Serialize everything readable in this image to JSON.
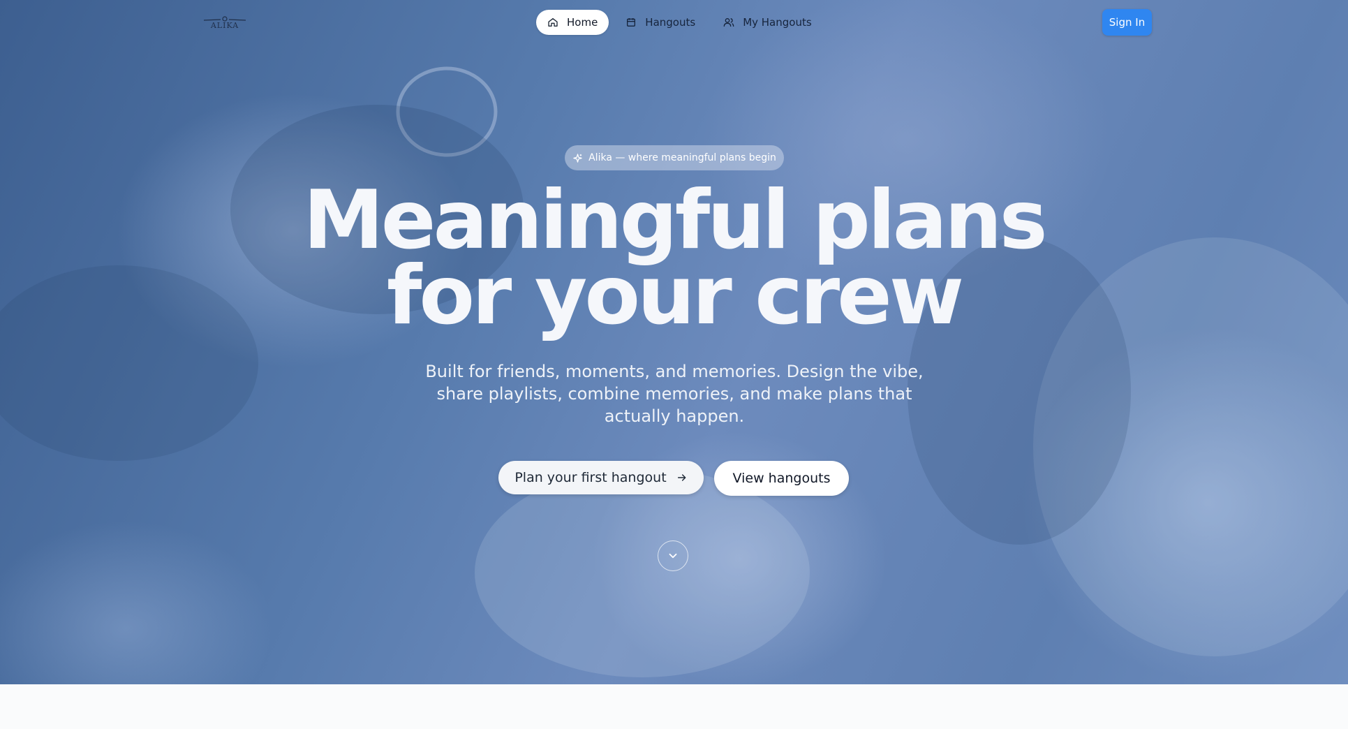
{
  "brand": {
    "logo_text": "ALIKA"
  },
  "nav": {
    "items": [
      {
        "label": "Home",
        "icon": "home-icon",
        "active": true
      },
      {
        "label": "Hangouts",
        "icon": "calendar-icon",
        "active": false
      },
      {
        "label": "My Hangouts",
        "icon": "users-icon",
        "active": false
      }
    ],
    "signin_label": "Sign In"
  },
  "hero": {
    "badge_text": "Alika — where meaningful plans begin",
    "badge_icon": "sparkles-icon",
    "headline_line1": "Meaningful plans",
    "headline_line2": "for your crew",
    "subtitle": "Built for friends, moments, and memories. Design the vibe, share playlists, combine memories, and make plans that actually happen.",
    "primary_cta": "Plan your first hangout",
    "primary_cta_icon": "arrow-right-icon",
    "secondary_cta": "View hangouts",
    "scroll_icon": "chevron-down-icon"
  },
  "colors": {
    "accent": "#2f86f0",
    "hero_overlay": "#577bad",
    "text_on_hero": "#f5f7fb"
  }
}
